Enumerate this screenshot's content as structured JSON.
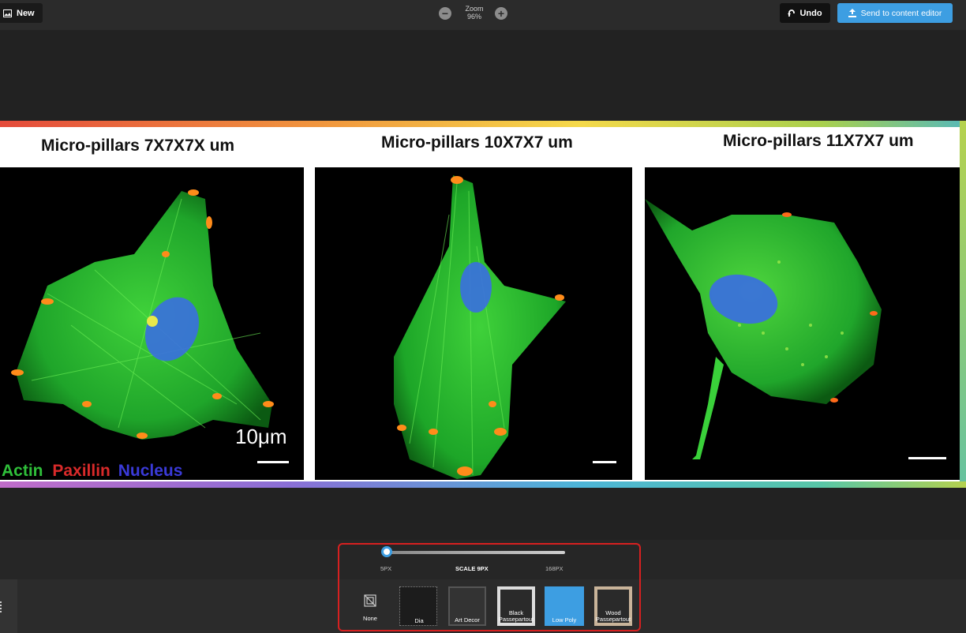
{
  "toolbar": {
    "new_label": "New",
    "zoom_label": "Zoom",
    "zoom_value": "96%",
    "undo_label": "Undo",
    "send_label": "Send to content editor"
  },
  "image": {
    "panels": [
      {
        "title": "Micro-pillars 7X7X7X um"
      },
      {
        "title": "Micro-pillars 10X7X7 um"
      },
      {
        "title": "Micro-pillars 11X7X7 um"
      }
    ],
    "scale_text": "10μm",
    "legend": {
      "actin": "Actin",
      "paxillin": "Paxillin",
      "nucleus": "Nucleus",
      "actin_color": "#2fbf3a",
      "paxillin_color": "#d92a2a",
      "nucleus_color": "#3a3ad8"
    }
  },
  "scale": {
    "min_label": "5PX",
    "current_label": "SCALE 9PX",
    "max_label": "168PX"
  },
  "frames": {
    "options": [
      {
        "label": "None"
      },
      {
        "label": "Dia"
      },
      {
        "label": "Art Decor"
      },
      {
        "label": "Black Passepartout"
      },
      {
        "label": "Low Poly"
      },
      {
        "label": "Wood Passepartout"
      }
    ]
  },
  "colors": {
    "accent": "#3d9ee2",
    "highlight_border": "#d72020"
  }
}
